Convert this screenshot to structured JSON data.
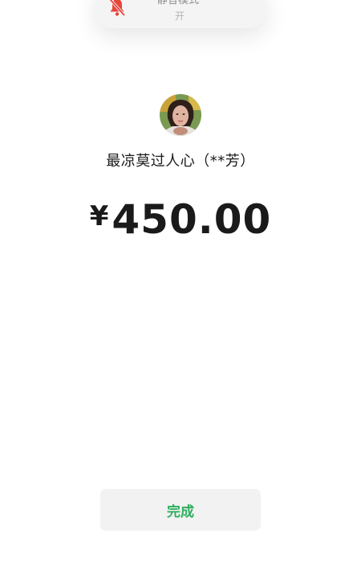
{
  "notification": {
    "title": "静音模式",
    "state": "开",
    "icon": "bell-slash-icon",
    "icon_color": "#e8463b"
  },
  "payee": {
    "avatar": "avatar",
    "name": "最凉莫过人心（**芳）"
  },
  "payment": {
    "currency": "¥",
    "amount": "450.00"
  },
  "actions": {
    "done_label": "完成",
    "done_color": "#2fae5e"
  }
}
